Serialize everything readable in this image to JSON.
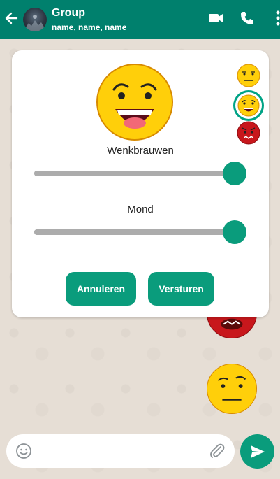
{
  "header": {
    "title": "Group",
    "subtitle": "name, name, name",
    "icons": [
      "back-arrow-icon",
      "video-call-icon",
      "phone-icon",
      "more-menu-icon"
    ],
    "color": "#00806d"
  },
  "mood_picker": {
    "options": [
      "neutral-face",
      "grinning-face",
      "angry-face"
    ],
    "selected": "grinning-face",
    "sliders": [
      {
        "label": "Wenkbrauwen",
        "value": 1.0
      },
      {
        "label": "Mond",
        "value": 1.0
      }
    ],
    "cancel_label": "Annuleren",
    "send_label": "Versturen"
  },
  "composer": {
    "placeholder": "",
    "icons": [
      "emoji-icon",
      "paperclip-icon",
      "send-icon"
    ]
  },
  "colors": {
    "accent": "#0a9c7c",
    "face_yellow": "#ffcf0a",
    "face_red": "#c8171c"
  }
}
